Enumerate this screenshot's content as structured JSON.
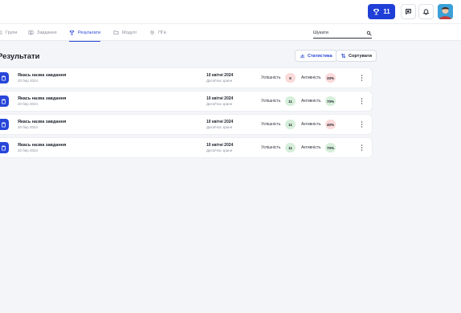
{
  "topbar": {
    "trophy_count": "11",
    "colors": {
      "brand": "#1f3fd6",
      "active_tab": "#2746d9"
    }
  },
  "nav": {
    "tabs": [
      {
        "label": "Групи",
        "icon": "users-icon",
        "active": false
      },
      {
        "label": "Завдання",
        "icon": "book-icon",
        "active": false
      },
      {
        "label": "Результати",
        "icon": "trophy-icon",
        "active": true
      },
      {
        "label": "Модулі",
        "icon": "folder-icon",
        "active": false
      },
      {
        "label": "ПГи",
        "icon": "gear-icon",
        "active": false
      }
    ],
    "search_placeholder": "Шукати"
  },
  "main": {
    "title": "Результати",
    "stats_label": "Статистика",
    "sort_label": "Сортувати"
  },
  "results": {
    "rows": [
      {
        "title": "Якась назва завдання",
        "created": "20 бер 2024",
        "date": "10 квітні 2024",
        "time": "Дата/Час зранн",
        "success_label": "Успішність",
        "success_value": "6",
        "success_status": "red",
        "activity_label": "Активність",
        "activity_value": "33%",
        "activity_status": "red"
      },
      {
        "title": "Якась назва завдання",
        "created": "20 бер 2024",
        "date": "10 квітні 2024",
        "time": "Дата/Час зранн",
        "success_label": "Успішність",
        "success_value": "11",
        "success_status": "green",
        "activity_label": "Активність",
        "activity_value": "70%",
        "activity_status": "green"
      },
      {
        "title": "Якась назва завдання",
        "created": "20 бер 2024",
        "date": "10 квітні 2024",
        "time": "Дата/Час зранн",
        "success_label": "Успішність",
        "success_value": "11",
        "success_status": "green",
        "activity_label": "Активність",
        "activity_value": "40%",
        "activity_status": "red"
      },
      {
        "title": "Якась назва завдання",
        "created": "20 бер 2024",
        "date": "10 квітні 2024",
        "time": "Дата/Час зранн",
        "success_label": "Успішність",
        "success_value": "11",
        "success_status": "green",
        "activity_label": "Активність",
        "activity_value": "70%",
        "activity_status": "green"
      }
    ]
  }
}
